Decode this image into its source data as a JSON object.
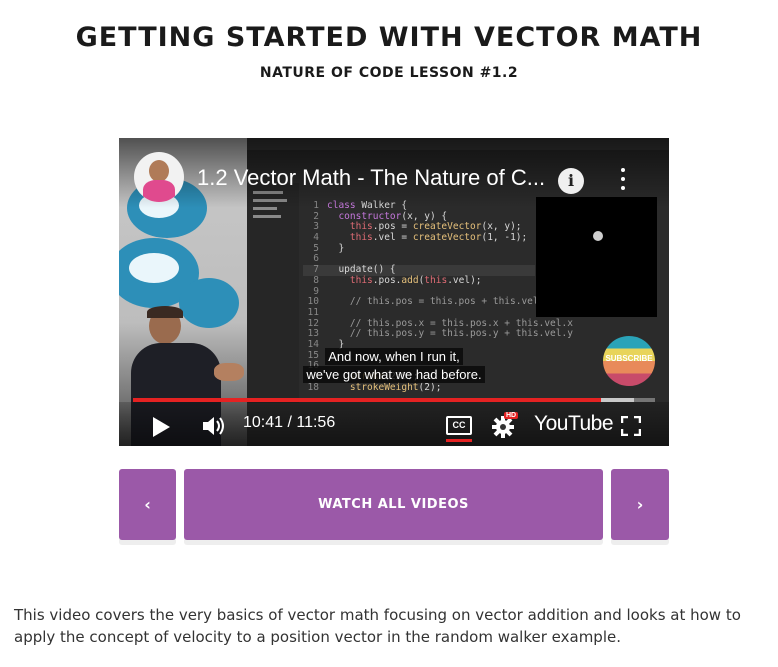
{
  "header": {
    "title": "GETTING STARTED WITH VECTOR MATH",
    "subtitle": "NATURE OF CODE LESSON #1.2"
  },
  "video": {
    "title": "1.2 Vector Math - The Nature of C...",
    "caption_line1": "And now, when I run it,",
    "caption_line2": "we've got what we had before.",
    "current_time": "10:41",
    "duration": "11:56",
    "time_display": "10:41 / 11:56",
    "progress": 0.896,
    "buffered": 0.96,
    "cc_label": "CC",
    "hd_badge": "HD",
    "brand": "YouTube",
    "subscribe_label": "SUBSCRIBE",
    "info_glyph": "i",
    "code_lines": [
      {
        "n": "1",
        "text": "class Walker {"
      },
      {
        "n": "2",
        "text": "  constructor(x, y) {"
      },
      {
        "n": "3",
        "text": "    this.pos = createVector(x, y);"
      },
      {
        "n": "4",
        "text": "    this.vel = createVector(1, -1);"
      },
      {
        "n": "5",
        "text": "  }"
      },
      {
        "n": "6",
        "text": ""
      },
      {
        "n": "7",
        "text": "  update() {"
      },
      {
        "n": "8",
        "text": "    this.pos.add(this.vel);"
      },
      {
        "n": "9",
        "text": ""
      },
      {
        "n": "10",
        "text": "    // this.pos = this.pos + this.vel;"
      },
      {
        "n": "11",
        "text": ""
      },
      {
        "n": "12",
        "text": "    // this.pos.x = this.pos.x + this.vel.x"
      },
      {
        "n": "13",
        "text": "    // this.pos.y = this.pos.y + this.vel.y"
      },
      {
        "n": "14",
        "text": "  }"
      },
      {
        "n": "15",
        "text": ""
      },
      {
        "n": "16",
        "text": ""
      },
      {
        "n": "17",
        "text": "    stroke(255);"
      },
      {
        "n": "18",
        "text": "    strokeWeight(2);"
      }
    ]
  },
  "nav": {
    "prev_label": "‹",
    "watch_all_label": "WATCH ALL VIDEOS",
    "next_label": "›"
  },
  "description": "This video covers the very basics of vector math focusing on vector addition and looks at how to apply the concept of velocity to a position vector in the random walker example.",
  "colors": {
    "button": "#9b59a8",
    "progress": "#e52222"
  }
}
